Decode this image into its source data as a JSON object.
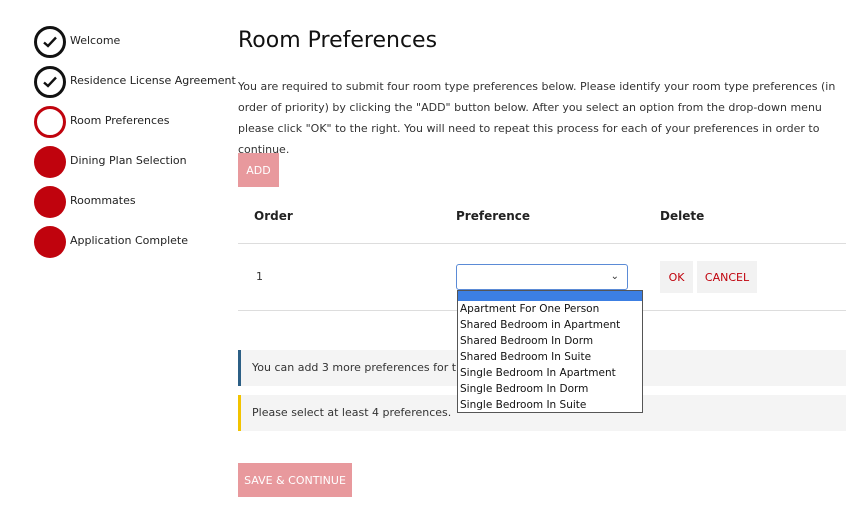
{
  "steps": [
    {
      "label": "Welcome",
      "status": "done",
      "icon": "check-icon"
    },
    {
      "label": "Residence License Agreement",
      "status": "done",
      "icon": "check-icon"
    },
    {
      "label": "Room Preferences",
      "status": "current"
    },
    {
      "label": "Dining Plan Selection",
      "status": "todo"
    },
    {
      "label": "Roommates",
      "status": "todo"
    },
    {
      "label": "Application Complete",
      "status": "todo"
    }
  ],
  "page": {
    "title": "Room Preferences",
    "intro": "You are required to submit four room type preferences below. Please identify your room type preferences (in order of priority) by clicking the \"ADD\" button below. After you select an option from the drop-down menu please click \"OK\" to the right. You will need to repeat this process for each of your preferences in order to continue."
  },
  "buttons": {
    "add": "ADD",
    "ok": "OK",
    "cancel": "CANCEL",
    "save_continue": "SAVE & CONTINUE"
  },
  "table": {
    "headers": {
      "order": "Order",
      "preference": "Preference",
      "delete": "Delete"
    },
    "rows": [
      {
        "order": "1",
        "preference": ""
      }
    ]
  },
  "dropdown": {
    "selected": "",
    "chevron_icon": "chevron-down-icon",
    "options": [
      "Apartment For One Person",
      "Shared Bedroom in Apartment",
      "Shared Bedroom In Dorm",
      "Shared Bedroom In Suite",
      "Single Bedroom In Apartment",
      "Single Bedroom In Dorm",
      "Single Bedroom In Suite"
    ]
  },
  "alerts": {
    "info": "You can add 3 more preferences for this",
    "warning": "Please select at least 4 preferences."
  },
  "colors": {
    "accent_red": "#c0030d",
    "button_disabled": "#e8999d",
    "highlight_blue": "#3c7fe3",
    "info_border": "#2c5f85",
    "warning_border": "#f2c300"
  }
}
